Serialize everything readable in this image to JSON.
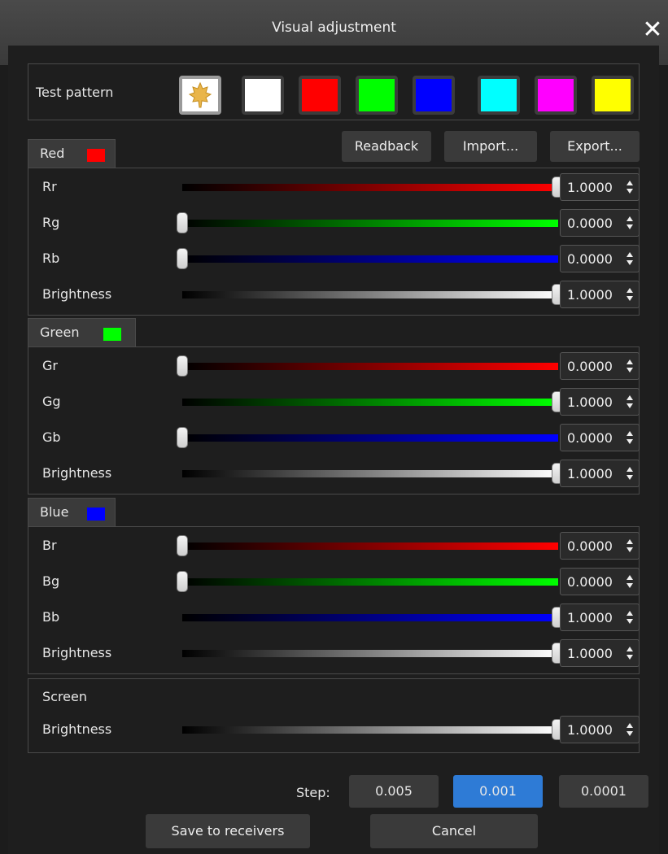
{
  "window": {
    "title": "Visual adjustment"
  },
  "test_pattern": {
    "label": "Test pattern",
    "swatches": [
      {
        "name": "logo",
        "color": "#ffffff",
        "icon": "maple-leaf-icon",
        "selected": true
      },
      {
        "name": "white",
        "color": "#ffffff"
      },
      {
        "name": "red",
        "color": "#ff0000"
      },
      {
        "name": "green",
        "color": "#00ff00"
      },
      {
        "name": "blue",
        "color": "#0000ff"
      },
      {
        "name": "cyan",
        "color": "#00ffff"
      },
      {
        "name": "magenta",
        "color": "#ff00ff"
      },
      {
        "name": "yellow",
        "color": "#ffff00"
      }
    ]
  },
  "actions": {
    "readback": "Readback",
    "import": "Import...",
    "export": "Export..."
  },
  "groups": [
    {
      "title": "Red",
      "chip": "#ff0000",
      "rows": [
        {
          "label": "Rr",
          "value": "1.0000",
          "level": 1,
          "color": "#ff0000"
        },
        {
          "label": "Rg",
          "value": "0.0000",
          "level": 0,
          "color": "#00ff00"
        },
        {
          "label": "Rb",
          "value": "0.0000",
          "level": 0,
          "color": "#0000ff"
        },
        {
          "label": "Brightness",
          "value": "1.0000",
          "level": 1,
          "color": "#ffffff"
        }
      ]
    },
    {
      "title": "Green",
      "chip": "#00ff00",
      "rows": [
        {
          "label": "Gr",
          "value": "0.0000",
          "level": 0,
          "color": "#ff0000"
        },
        {
          "label": "Gg",
          "value": "1.0000",
          "level": 1,
          "color": "#00ff00"
        },
        {
          "label": "Gb",
          "value": "0.0000",
          "level": 0,
          "color": "#0000ff"
        },
        {
          "label": "Brightness",
          "value": "1.0000",
          "level": 1,
          "color": "#ffffff"
        }
      ]
    },
    {
      "title": "Blue",
      "chip": "#0000ff",
      "rows": [
        {
          "label": "Br",
          "value": "0.0000",
          "level": 0,
          "color": "#ff0000"
        },
        {
          "label": "Bg",
          "value": "0.0000",
          "level": 0,
          "color": "#00ff00"
        },
        {
          "label": "Bb",
          "value": "1.0000",
          "level": 1,
          "color": "#0000ff"
        },
        {
          "label": "Brightness",
          "value": "1.0000",
          "level": 1,
          "color": "#ffffff"
        }
      ]
    }
  ],
  "screen": {
    "title": "Screen",
    "row": {
      "label": "Brightness",
      "value": "1.0000",
      "level": 1,
      "color": "#ffffff"
    }
  },
  "step": {
    "label": "Step:",
    "options": [
      "0.005",
      "0.001",
      "0.0001"
    ],
    "selected": "0.001"
  },
  "footer": {
    "save": "Save to receivers",
    "cancel": "Cancel"
  }
}
